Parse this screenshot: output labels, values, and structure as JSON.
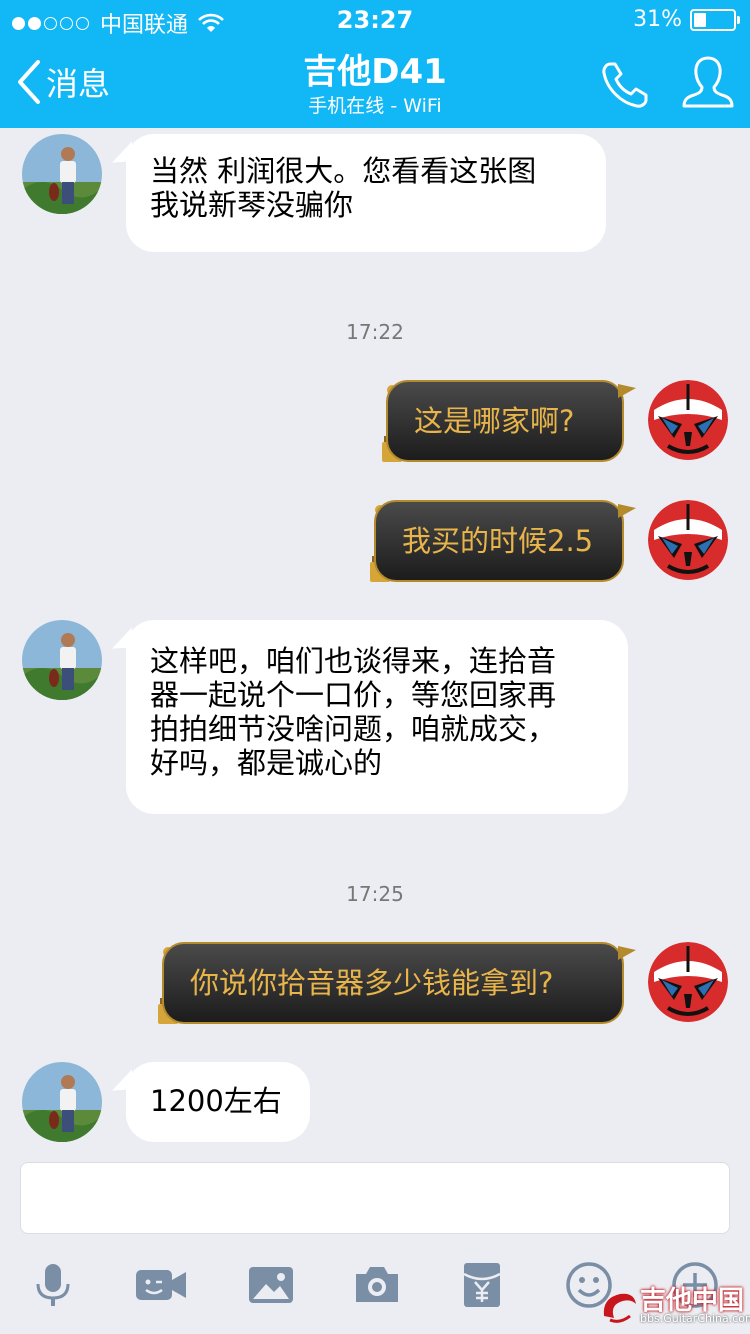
{
  "status_bar": {
    "carrier": "中国联通",
    "time": "23:27",
    "battery": "31%",
    "battery_level": 0.31,
    "signal_dots_filled": 2,
    "signal_dots_total": 5
  },
  "header": {
    "back_label": "消息",
    "title": "吉他D41",
    "subtitle": "手机在线 - WiFi",
    "color": "#12b7f5"
  },
  "messages": [
    {
      "type": "in",
      "text_lines": [
        "当然 利润很大。您看看这张图",
        "我说新琴没骗你"
      ]
    },
    {
      "type": "time",
      "text": "17:22"
    },
    {
      "type": "out",
      "text": "这是哪家啊?"
    },
    {
      "type": "out",
      "text": "我买的时候2.5"
    },
    {
      "type": "in",
      "text_lines": [
        "这样吧，咱们也谈得来，连拾音",
        "器一起说个一口价，等您回家再",
        "拍拍细节没啥问题，咱就成交，",
        "好吗，都是诚心的"
      ]
    },
    {
      "type": "time",
      "text": "17:25"
    },
    {
      "type": "out",
      "text": "你说你拾音器多少钱能拿到?"
    },
    {
      "type": "in",
      "text_lines": [
        "1200左右"
      ]
    }
  ],
  "toolbar": {
    "icons": [
      "microphone-icon",
      "video-icon",
      "image-icon",
      "camera-icon",
      "red-packet-icon",
      "emoji-icon",
      "plus-icon"
    ]
  },
  "watermark": {
    "text": "吉他中国",
    "url": "bbs.GuitarChina.com"
  },
  "colors": {
    "incoming_bubble": "#ffffff",
    "outgoing_bubble": "#2a2a2a",
    "outgoing_text": "#e9b54a",
    "background": "#ebedf2"
  }
}
